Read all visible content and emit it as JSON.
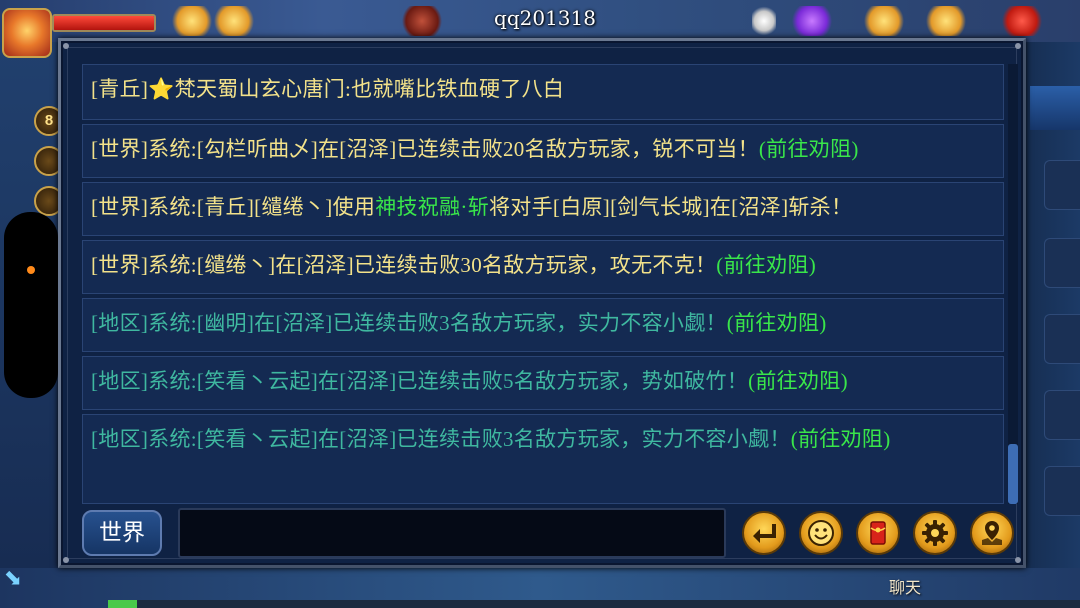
{
  "hud": {
    "player_name": "qq201318",
    "hp_fraction": 1.0,
    "side_button_labels": [
      "8"
    ],
    "xp_fraction": 0.03
  },
  "chat": {
    "messages": [
      {
        "parts": [
          {
            "text": "[青丘]",
            "color": "#f3e28a"
          },
          {
            "text": "⭐",
            "color": "#ffcc33"
          },
          {
            "text": "梵天蜀山玄心唐门:也就嘴比铁血硬了八白",
            "color": "#f3e28a"
          }
        ]
      },
      {
        "parts": [
          {
            "text": "[世界]系统:[勾栏听曲乄]在[沼泽]已连续击败20名敌方玩家，锐不可当！",
            "color": "#f3e28a"
          },
          {
            "text": "(前往劝阻)",
            "color": "#39e64a"
          }
        ]
      },
      {
        "parts": [
          {
            "text": "[世界]系统:[青丘][缱绻丶]使用",
            "color": "#f3e28a"
          },
          {
            "text": "神技祝融·斩",
            "color": "#39e64a"
          },
          {
            "text": "将对手[白原][剑气长城]在[沼泽]斩杀！",
            "color": "#f3e28a"
          }
        ]
      },
      {
        "parts": [
          {
            "text": "[世界]系统:[缱绻丶]在[沼泽]已连续击败30名敌方玩家，攻无不克！",
            "color": "#f3e28a"
          },
          {
            "text": "(前往劝阻)",
            "color": "#39e64a"
          }
        ]
      },
      {
        "parts": [
          {
            "text": "[地区]系统:[幽明]在[沼泽]已连续击败3名敌方玩家，实力不容小觑！",
            "color": "#3fb8a0"
          },
          {
            "text": "(前往劝阻)",
            "color": "#39e64a"
          }
        ]
      },
      {
        "parts": [
          {
            "text": "[地区]系统:[笑看丶云起]在[沼泽]已连续击败5名敌方玩家，势如破竹！",
            "color": "#3fb8a0"
          },
          {
            "text": "(前往劝阻)",
            "color": "#39e64a"
          }
        ]
      },
      {
        "parts": [
          {
            "text": "[地区]系统:[笑看丶云起]在[沼泽]已连续击败3名敌方玩家，实力不容小觑！",
            "color": "#3fb8a0"
          },
          {
            "text": "(前往劝阻)",
            "color": "#39e64a"
          }
        ]
      }
    ],
    "channel_label": "世界",
    "input_value": "",
    "input_placeholder": "",
    "buttons": [
      {
        "name": "send-button",
        "icon": "enter-arrow-icon"
      },
      {
        "name": "emoji-button",
        "icon": "smiley-icon"
      },
      {
        "name": "red-packet-button",
        "icon": "red-envelope-icon"
      },
      {
        "name": "settings-button",
        "icon": "gear-icon"
      },
      {
        "name": "location-button",
        "icon": "map-pin-icon"
      }
    ]
  },
  "footer": {
    "chat_tab_label": "聊天"
  }
}
